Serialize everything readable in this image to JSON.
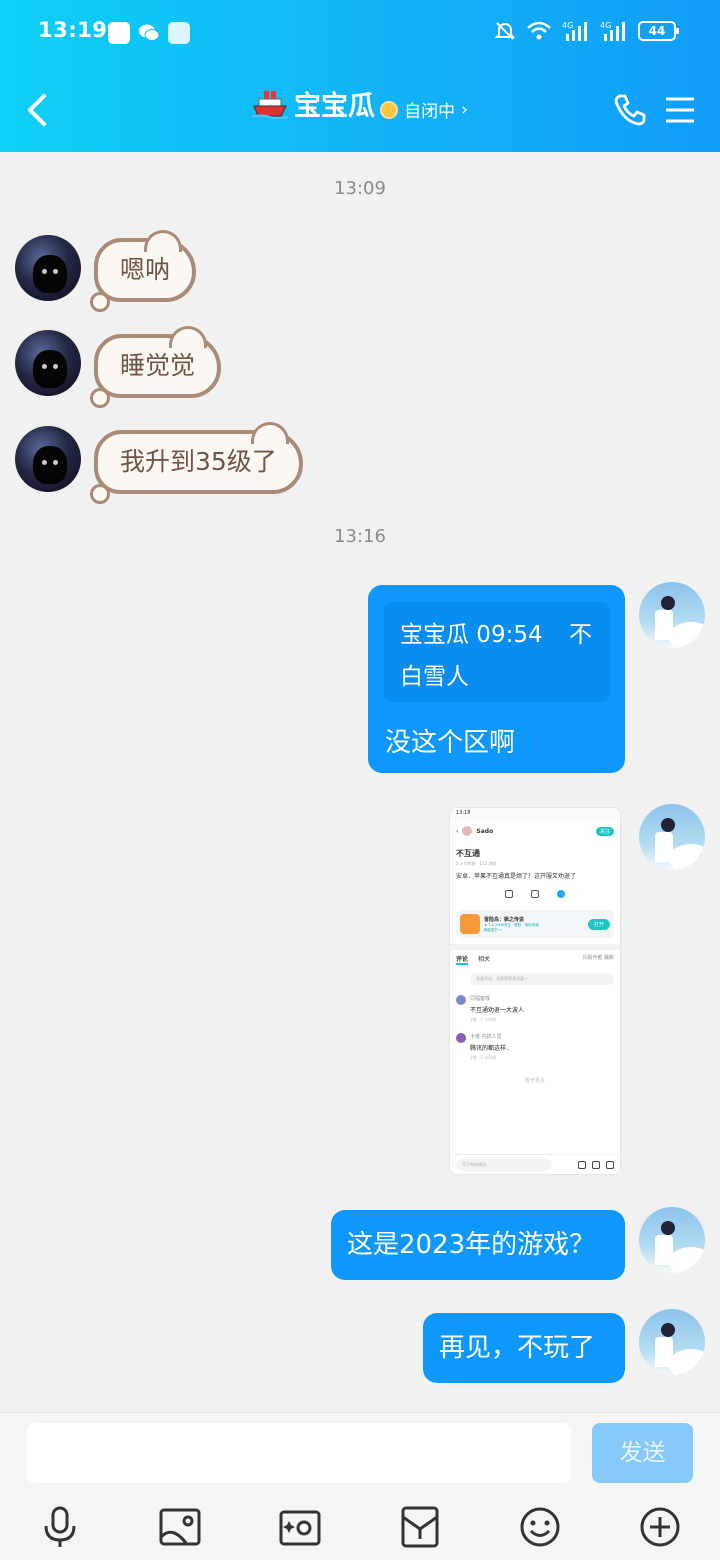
{
  "status_bar": {
    "time": "13:19",
    "battery": "44",
    "network": [
      "4G",
      "4G"
    ]
  },
  "header": {
    "title": "宝宝瓜",
    "status": "自闭中",
    "status_arrow": "›"
  },
  "timestamps": [
    "13:09",
    "13:16"
  ],
  "incoming": [
    {
      "text": "嗯呐"
    },
    {
      "text": "睡觉觉"
    },
    {
      "text": "我升到35级了"
    }
  ],
  "outgoing_reply": {
    "quote_header": "宝宝瓜 09:54",
    "quote_close": "不",
    "quote_text": "白雪人",
    "text": "没这个区啊"
  },
  "screenshot": {
    "time": "13:18",
    "user": "Sado",
    "follow": "关注",
    "title": "不互通",
    "meta": "2.3 小时前  · 132 浏览",
    "body": "安卓、苹果不互通真是烦了！这开服又劝退了",
    "game_name": "冒险岛：枫之传说",
    "game_sub": "★ 7.4   3.6W关注  · 冒险 · 角色扮演",
    "game_tag": "精品发行 >",
    "open": "打开",
    "tab_comments": "评论",
    "tab_related": "相关",
    "tab_right": "只看作者  最新",
    "comment_placeholder": "发表评论，也获得更多回复～",
    "comments": [
      {
        "name": "同福客栈",
        "text": "不互通劝退一大波人",
        "meta": "1楼 · 1 小时前"
      },
      {
        "name": "卡塔·内扰人员",
        "text": "腾讯的都这样..",
        "meta": "2楼 · 1 小时前"
      }
    ],
    "more": "暂无更多",
    "bottom_placeholder": "写下你的想法..."
  },
  "outgoing": [
    {
      "text": "这是2023年的游戏？"
    },
    {
      "text": "再见，不玩了"
    }
  ],
  "input": {
    "value": "",
    "send_label": "发送"
  }
}
